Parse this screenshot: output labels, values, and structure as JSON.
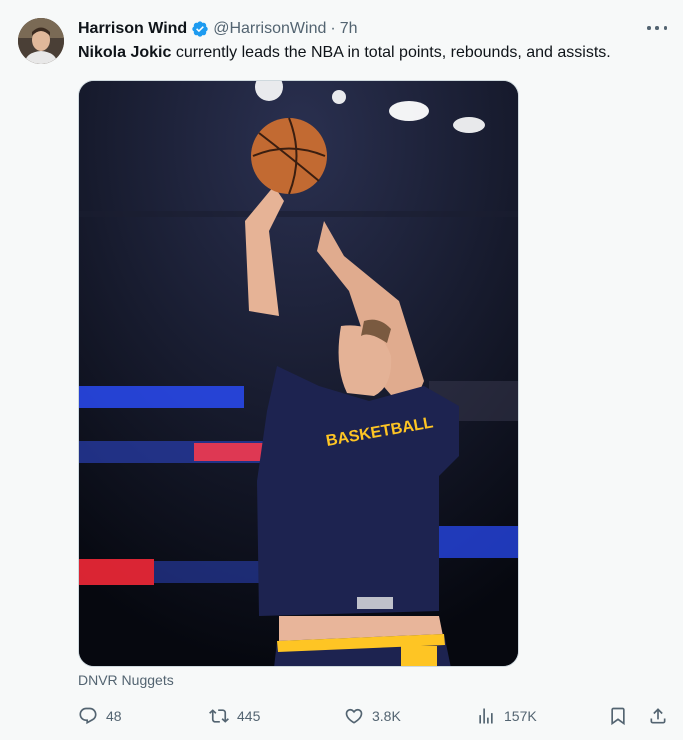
{
  "author": {
    "name": "Harrison Wind",
    "handle": "@HarrisonWind",
    "separator": "·",
    "time": "7h"
  },
  "tweet": {
    "mention": "Nikola Jokic",
    "text": " currently leads the NBA in total points, rebounds, and assists."
  },
  "media": {
    "jersey_text": "BASKETBALL",
    "source": "DNVR Nuggets"
  },
  "stats": {
    "replies": "48",
    "reposts": "445",
    "likes": "3.8K",
    "views": "157K"
  },
  "icons": [
    "verified-badge-icon",
    "more-icon",
    "reply-icon",
    "repost-icon",
    "like-icon",
    "views-icon",
    "bookmark-icon",
    "share-icon"
  ],
  "colors": {
    "verified": "#1d9bf0",
    "muted": "#536471",
    "text": "#0f1419",
    "jersey": "#1d2350",
    "jersey_accent": "#fec524"
  }
}
